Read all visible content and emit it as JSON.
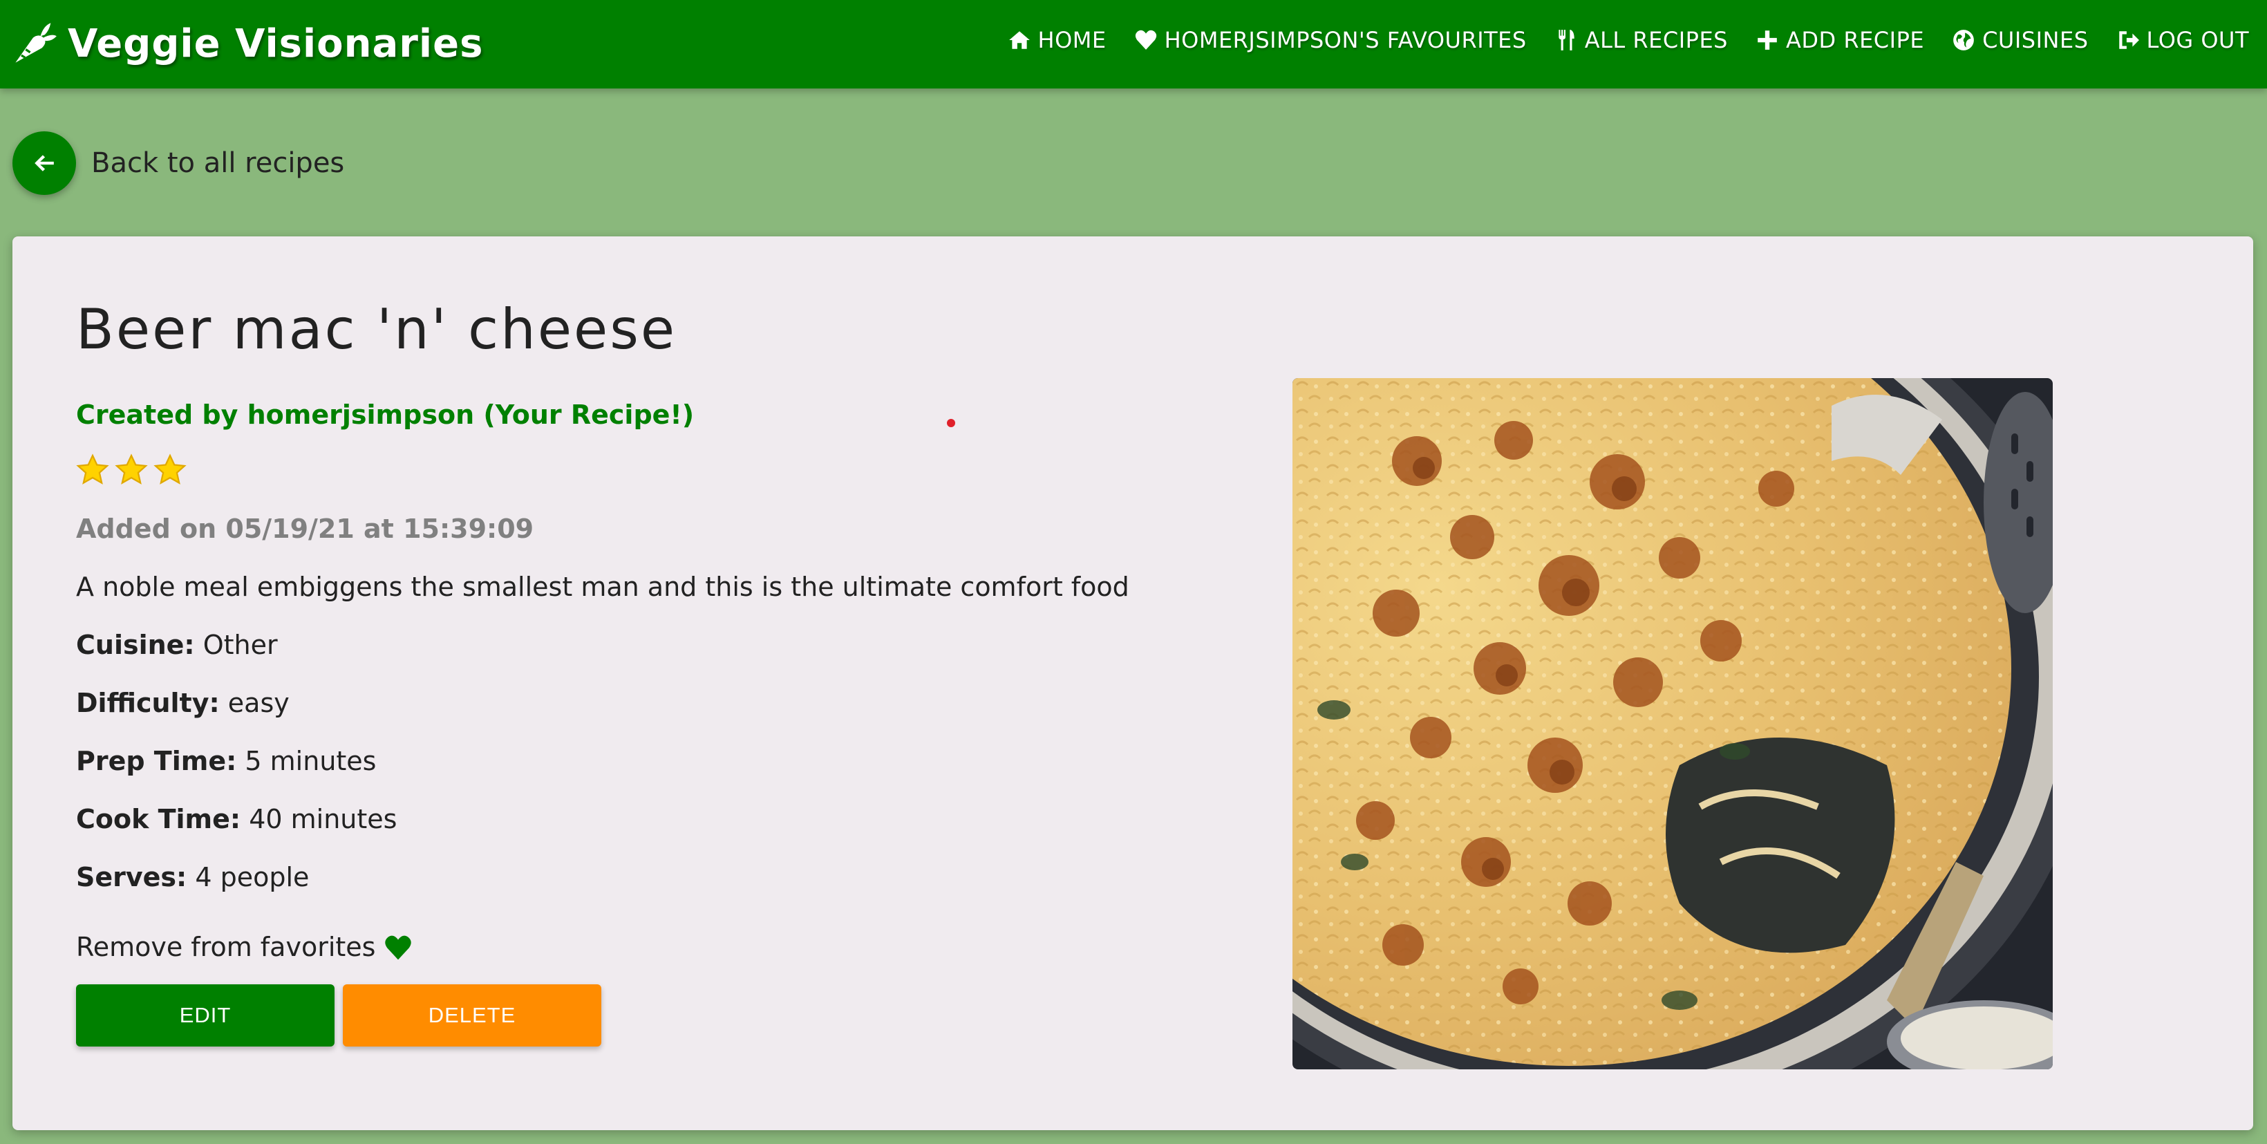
{
  "app": {
    "brand": "Veggie Visionaries"
  },
  "nav": {
    "items": [
      {
        "label": "HOME",
        "icon": "home-icon"
      },
      {
        "label": "HOMERJSIMPSON'S FAVOURITES",
        "icon": "heart-icon"
      },
      {
        "label": "ALL RECIPES",
        "icon": "utensils-icon"
      },
      {
        "label": "ADD RECIPE",
        "icon": "plus-icon"
      },
      {
        "label": "CUISINES",
        "icon": "globe-icon"
      },
      {
        "label": "LOG OUT",
        "icon": "sign-out-icon"
      }
    ]
  },
  "back": {
    "label": "Back to all recipes",
    "icon": "arrow-left-icon"
  },
  "recipe": {
    "title": "Beer mac 'n' cheese",
    "created_by": "Created by homerjsimpson (Your Recipe!)",
    "rating": 3,
    "added_on": "Added on 05/19/21 at 15:39:09",
    "description": "A noble meal embiggens the smallest man and this is the ultimate comfort food",
    "cuisine_label": "Cuisine:",
    "cuisine": "Other",
    "difficulty_label": "Difficulty:",
    "difficulty": "easy",
    "prep_label": "Prep Time:",
    "prep_time": "5 minutes",
    "cook_label": "Cook Time:",
    "cook_time": "40 minutes",
    "serves_label": "Serves:",
    "serves": "4 people",
    "favorite_text": "Remove from favorites",
    "image_subject": "baked macaroni and cheese in a pan"
  },
  "actions": {
    "edit_label": "EDIT",
    "delete_label": "DELETE"
  },
  "colors": {
    "primary": "#008000",
    "page_bg": "#8ab87c",
    "card_bg": "#f0ebef",
    "delete": "#ff8c00",
    "star": "#ffd200"
  }
}
